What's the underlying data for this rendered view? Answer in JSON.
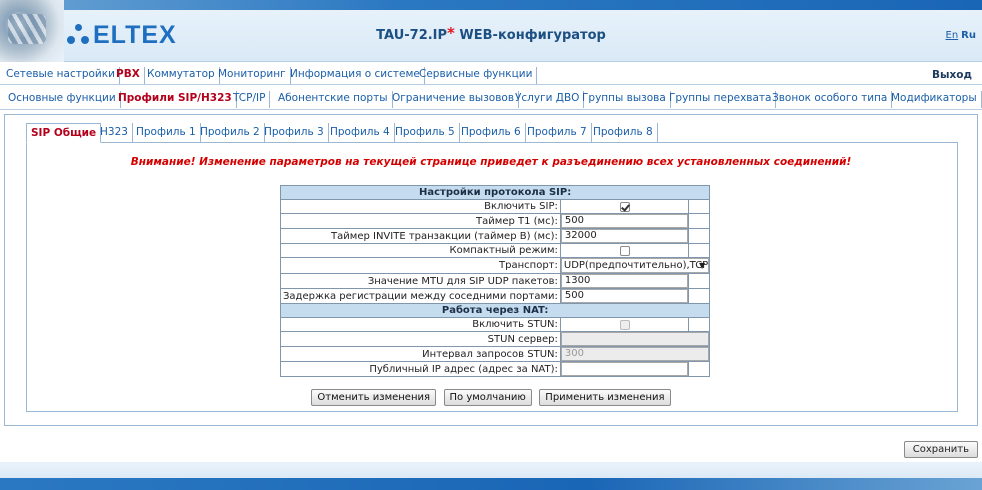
{
  "header": {
    "logo_text": "ELTEX",
    "app_title_main": "TAU-72.IP",
    "app_title_star": "*",
    "app_title_suffix": " WEB-конфигуратор",
    "lang_en": "En",
    "lang_ru": "Ru"
  },
  "menu_main": {
    "items": [
      "Сетевые настройки",
      "PBX",
      "Коммутатор",
      "Мониторинг",
      "Информация о системе",
      "Сервисные функции"
    ],
    "active": "PBX",
    "exit_label": "Выход"
  },
  "menu_sub": {
    "items": [
      "Основные функции",
      "Профили SIP/H323",
      "TCP/IP",
      "Абонентские порты",
      "Ограничение вызовов",
      "Услуги ДВО",
      "Группы вызова",
      "Группы перехвата",
      "Звонок особого типа",
      "Модификаторы"
    ],
    "active": "Профили SIP/H323"
  },
  "tabs": {
    "items": [
      "SIP Общие",
      "H323",
      "Профиль 1",
      "Профиль 2",
      "Профиль 3",
      "Профиль 4",
      "Профиль 5",
      "Профиль 6",
      "Профиль 7",
      "Профиль 8"
    ],
    "active": "SIP Общие"
  },
  "warning": "Внимание! Изменение параметров на текущей странице приведет к разъединению всех установленных соединений!",
  "sip_section": {
    "title": "Настройки протокола SIP:",
    "enable_sip_label": "Включить SIP:",
    "enable_sip_checked": true,
    "t1_label": "Таймер T1 (мс):",
    "t1_value": "500",
    "timer_b_label": "Таймер INVITE транзакции (таймер B) (мс):",
    "timer_b_value": "32000",
    "compact_label": "Компактный режим:",
    "compact_checked": false,
    "transport_label": "Транспорт:",
    "transport_value": "UDP(предпочтительно),TCP",
    "mtu_label": "Значение MTU для SIP UDP пакетов:",
    "mtu_value": "1300",
    "reg_delay_label": "Задержка регистрации между соседними портами:",
    "reg_delay_value": "500"
  },
  "nat_section": {
    "title": "Работа через NAT:",
    "stun_enable_label": "Включить STUN:",
    "stun_enable_checked": false,
    "stun_server_label": "STUN сервер:",
    "stun_server_value": "",
    "stun_interval_label": "Интервал запросов STUN:",
    "stun_interval_value": "300",
    "public_ip_label": "Публичный IP адрес (адрес за NAT):",
    "public_ip_value": ""
  },
  "buttons": {
    "cancel": "Отменить изменения",
    "default": "По умолчанию",
    "apply": "Применить изменения",
    "save": "Сохранить"
  }
}
